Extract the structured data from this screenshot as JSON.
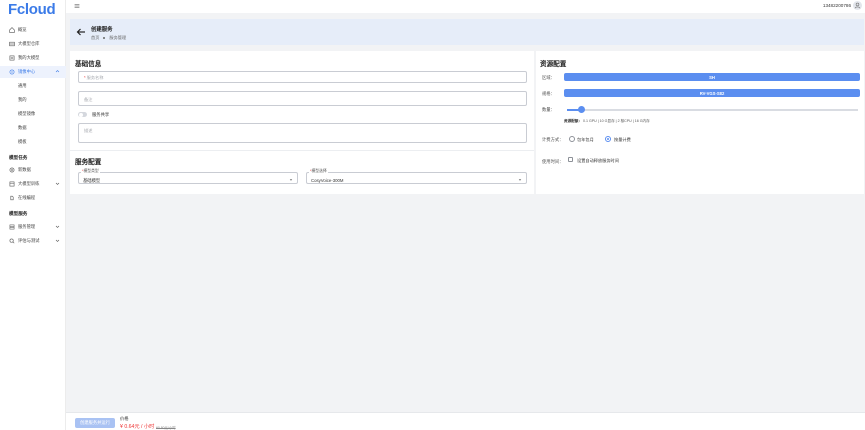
{
  "app": {
    "logo": "Fcloud"
  },
  "topbar": {
    "phone": "13482200786"
  },
  "sidebar": {
    "items": [
      {
        "label": "概览",
        "icon": "home-icon"
      },
      {
        "label": "大模型仓库",
        "icon": "database-icon"
      },
      {
        "label": "我的大模型",
        "icon": "box-icon"
      },
      {
        "label": "镜像中心",
        "icon": "image-icon"
      }
    ],
    "image_sub": [
      "通用",
      "我的",
      "模型镜像",
      "数据",
      "模板"
    ],
    "group_tasks": "模型任务",
    "task_items": [
      {
        "label": "新数据",
        "icon": "plus-circle-icon"
      },
      {
        "label": "大模型训练",
        "icon": "train-icon"
      },
      {
        "label": "在线编程",
        "icon": "code-icon"
      }
    ],
    "group_service": "模型服务",
    "service_items": [
      {
        "label": "服务管理",
        "icon": "server-icon"
      },
      {
        "label": "评估与测试",
        "icon": "search-icon"
      }
    ]
  },
  "header": {
    "title": "创建服务",
    "breadcrumb": [
      "首页",
      "服务管理"
    ]
  },
  "basic": {
    "title": "基础信息",
    "name_placeholder": "服务名称",
    "remark_placeholder": "备注",
    "share_label": "服务共享",
    "desc_placeholder": "描述"
  },
  "service_config": {
    "title": "服务配置",
    "type_label": "模型类型",
    "type_value": "基础模型",
    "model_label": "模型选择",
    "model_value": "CosyVoice-300M"
  },
  "resource": {
    "title": "资源配置",
    "region_label": "区域：",
    "region_value": "SH",
    "spec_label": "规格：",
    "spec_value": "RV-VGS-S82",
    "count_label": "数量：",
    "count_fraction": 0.05,
    "info_prefix": "资源配额：",
    "info_value": "0.1 GPU  |  10 G显存  |  2 核CPU  |  16 G内存",
    "billing_label": "计费方式：",
    "billing_options": [
      "包年包月",
      "按量计费"
    ],
    "duration_label": "使用时间：",
    "duration_checkbox": "设置自动释放服务时间"
  },
  "footer": {
    "submit_label": "创建服务并运行",
    "price_label": "价格",
    "price_value": "¥ 0.64元 / 小时",
    "price_original": "¥0.80元/小时"
  },
  "colors": {
    "primary": "#5b8ef0",
    "accent": "#3b7be8",
    "danger": "#e33333"
  }
}
